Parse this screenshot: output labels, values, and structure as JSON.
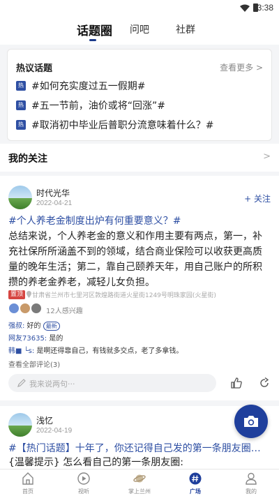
{
  "status_bar": {
    "time": "3:38"
  },
  "top_tabs": [
    {
      "label": "话题圈"
    },
    {
      "label": "问吧"
    },
    {
      "label": "社群"
    }
  ],
  "hot_topics": {
    "title": "热议话题",
    "more": "查看更多 >",
    "badge": "热",
    "items": [
      {
        "text": "#如何充实度过五一假期#"
      },
      {
        "text": "#五一节前，油价或将“回涨”#"
      },
      {
        "text": "#取消初中毕业后普职分流意味着什么？#"
      }
    ]
  },
  "my_follow": {
    "label": "我的关注",
    "chevron": ">"
  },
  "posts": [
    {
      "user": "时代光华",
      "date": "2022-04-21",
      "follow": "+ 关注",
      "topic": "#个人养老金制度出炉有何重要意义？#",
      "body": "总结来说，个人养老金的意义和作用主要有两点，第一，补充社保所所涵盖不到的领域，结合商业保险可以收获更高质量的晚年生活；第二，靠自己颐养天年，用自己账户的所积攒的养老金养老，减轻儿女负担。",
      "pin": "置顶",
      "location": "甘肃省兰州市七里河区敦煌路街道火星街1249号明珠家园(火星街)",
      "interest": "12人感兴趣",
      "comments": [
        {
          "name": "强叔:",
          "text": " 好的 ",
          "chip": "最新"
        },
        {
          "name": "网友73635:",
          "text": " 是的",
          "chip": ""
        },
        {
          "name": "韩■ └s:",
          "text": " 是啊还得靠自己，有钱就多交点，老了多拿钱。",
          "chip": ""
        }
      ],
      "view_all": "查看全部评论(3)",
      "reply_placeholder": "我来说两句···"
    },
    {
      "user": "浅忆",
      "date": "2022-04-19",
      "topic": "#【热门话题】十年了，你还记得自己发的第一条朋友圈…",
      "body": "{温馨提示} 怎么看自己的第一条朋友圈:"
    }
  ],
  "bottom_nav": [
    {
      "label": "首页"
    },
    {
      "label": "视听"
    },
    {
      "label": "掌上兰州"
    },
    {
      "label": "广场"
    },
    {
      "label": "我的"
    }
  ],
  "colors": {
    "accent": "#1f3f9c",
    "link": "#2e4fa3",
    "pin": "#d64541"
  }
}
